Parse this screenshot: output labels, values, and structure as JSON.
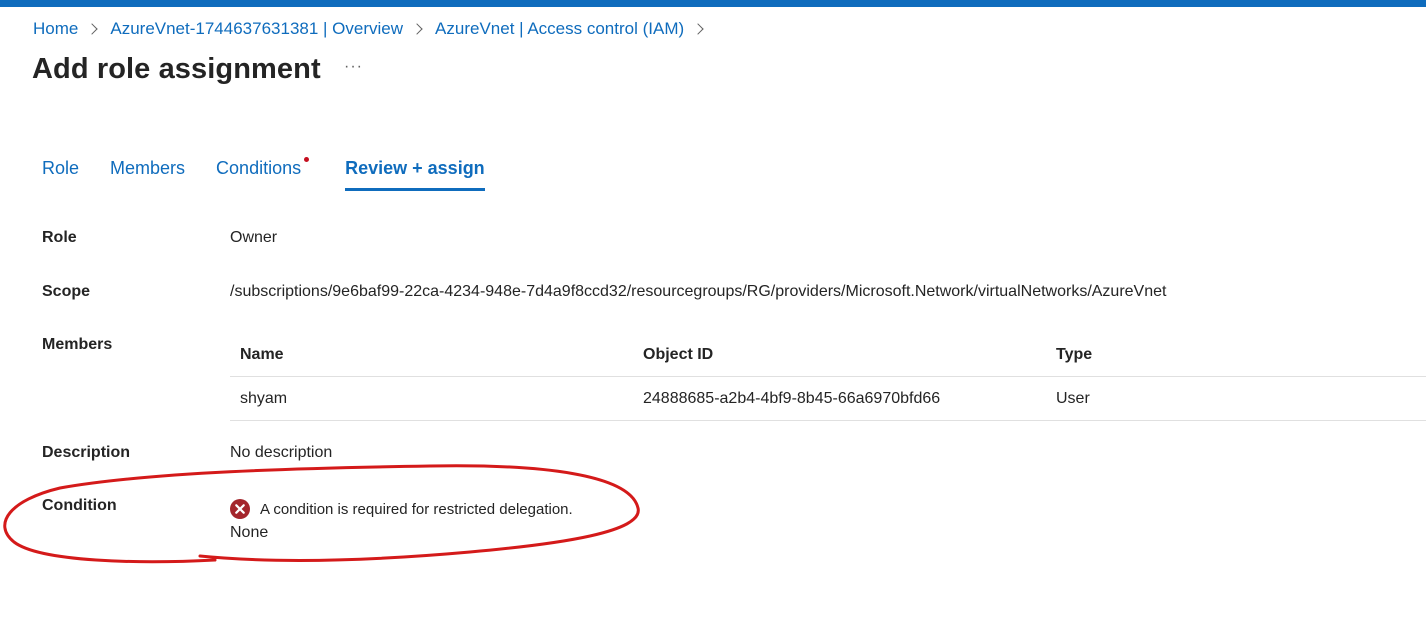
{
  "breadcrumb": [
    "Home",
    "AzureVnet-1744637631381 | Overview",
    "AzureVnet | Access control (IAM)"
  ],
  "page_title": "Add role assignment",
  "more_label": "···",
  "tabs": [
    {
      "label": "Role",
      "active": false
    },
    {
      "label": "Members",
      "active": false
    },
    {
      "label": "Conditions",
      "active": false,
      "indicator": true
    },
    {
      "label": "Review + assign",
      "active": true
    }
  ],
  "review": {
    "role_label": "Role",
    "role_value": "Owner",
    "scope_label": "Scope",
    "scope_value": "/subscriptions/9e6baf99-22ca-4234-948e-7d4a9f8ccd32/resourcegroups/RG/providers/Microsoft.Network/virtualNetworks/AzureVnet",
    "members_label": "Members",
    "members_table": {
      "headers": [
        "Name",
        "Object ID",
        "Type"
      ],
      "rows": [
        [
          "shyam",
          "24888685-a2b4-4bf9-8b45-66a6970bfd66",
          "User"
        ]
      ]
    },
    "description_label": "Description",
    "description_value": "No description",
    "condition_label": "Condition",
    "condition_error": "A condition is required for restricted delegation.",
    "condition_value": "None"
  },
  "colors": {
    "accent": "#0f6cbd",
    "error": "#a4262c",
    "annotation": "#d41a1a",
    "indicator_dot": "#c50f1f"
  },
  "icons": {
    "error": "error-circle-icon",
    "breadcrumb_separator": "chevron-right-icon"
  }
}
